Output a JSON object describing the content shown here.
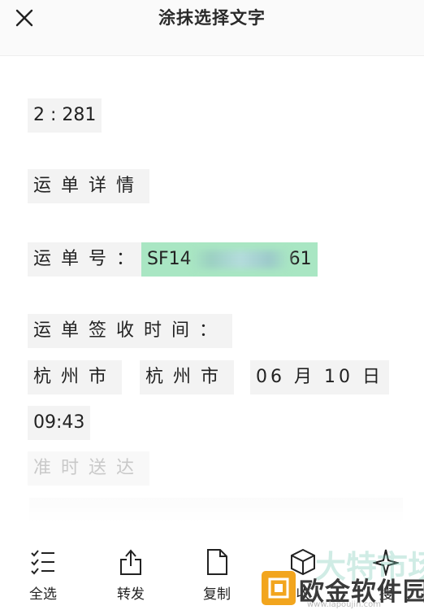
{
  "header": {
    "title": "涂抹选择文字",
    "close_icon": "close-icon"
  },
  "content": {
    "line1": "2 : 281",
    "line2": "运单详情",
    "waybill_label": "运单号：",
    "waybill_prefix": "SF14",
    "waybill_suffix": "61",
    "sign_label": "运单签收时间：",
    "city1": "杭州市",
    "city2": "杭州市",
    "date": "06 月 10 日",
    "time": "09:43",
    "status": "准时送达"
  },
  "toolbar": {
    "select_all": "全选",
    "forward": "转发",
    "copy": "复制",
    "collect_partial": "收",
    "search_partial": "搜"
  },
  "watermark": {
    "text": "欧金软件园",
    "url": "www.lapoujin.com",
    "ghost": "大特市场"
  },
  "colors": {
    "highlight": "#a9e6c3",
    "watermark_logo": "#f2a51d"
  }
}
